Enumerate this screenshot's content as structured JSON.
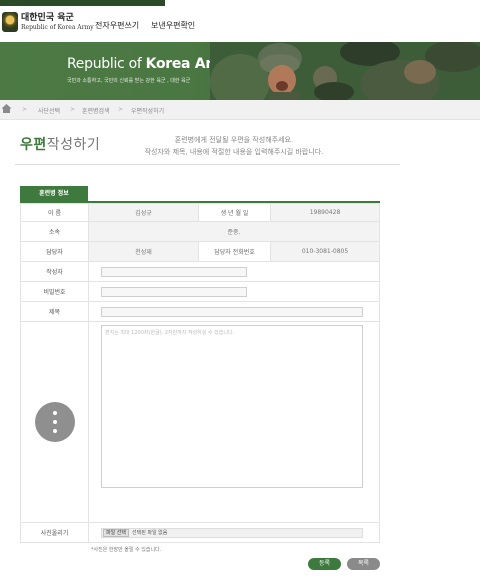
{
  "header": {
    "logo_ko": "대한민국 육군",
    "logo_en": "Republic of Korea Army",
    "nav": [
      "전자우편쓰기",
      "보낸우편확인"
    ]
  },
  "banner": {
    "title_pre": "Republic of ",
    "title_bold": "Korea Army",
    "subtitle": "국민과 소통하고, 국민의 신뢰를 받는 강한 육군 , 대한 육군"
  },
  "breadcrumb": [
    "사단선택",
    "훈련병검색",
    "우편작성하기"
  ],
  "page": {
    "title_accent": "우편",
    "title_rest": "작성하기",
    "intro_line1": "훈련병에게 전달될 우편을 작성해주세요.",
    "intro_line2": "작성자와 제목, 내용에 적절한 내용을 입력해주시길 바랍니다."
  },
  "section_tab": "훈련병 정보",
  "form": {
    "name_label": "이  름",
    "name_value": "김성규",
    "birth_label": "생 년 월 일",
    "birth_value": "19890428",
    "unit_label": "소속",
    "unit_value": "준중.",
    "manager_label": "담당자",
    "manager_value": "천성재",
    "manager_phone_label": "담당자 전화번호",
    "manager_phone_value": "010-3081-0805",
    "author_label": "작성자",
    "password_label": "비밀번호",
    "subject_label": "제목",
    "content_placeholder": "편지는 최대 1200자(한글), 2자만까지 작성하실 수 있습니다.",
    "photo_label": "사진올리기",
    "file_button": "파일 선택",
    "file_status": "선택된 파일 없음",
    "photo_note": "*사진은 한장만 올릴 수 있습니다."
  },
  "buttons": {
    "ok": "등록",
    "list": "목록"
  },
  "colors": {
    "accent": "#3e7a3d",
    "banner": "#4a7742"
  }
}
